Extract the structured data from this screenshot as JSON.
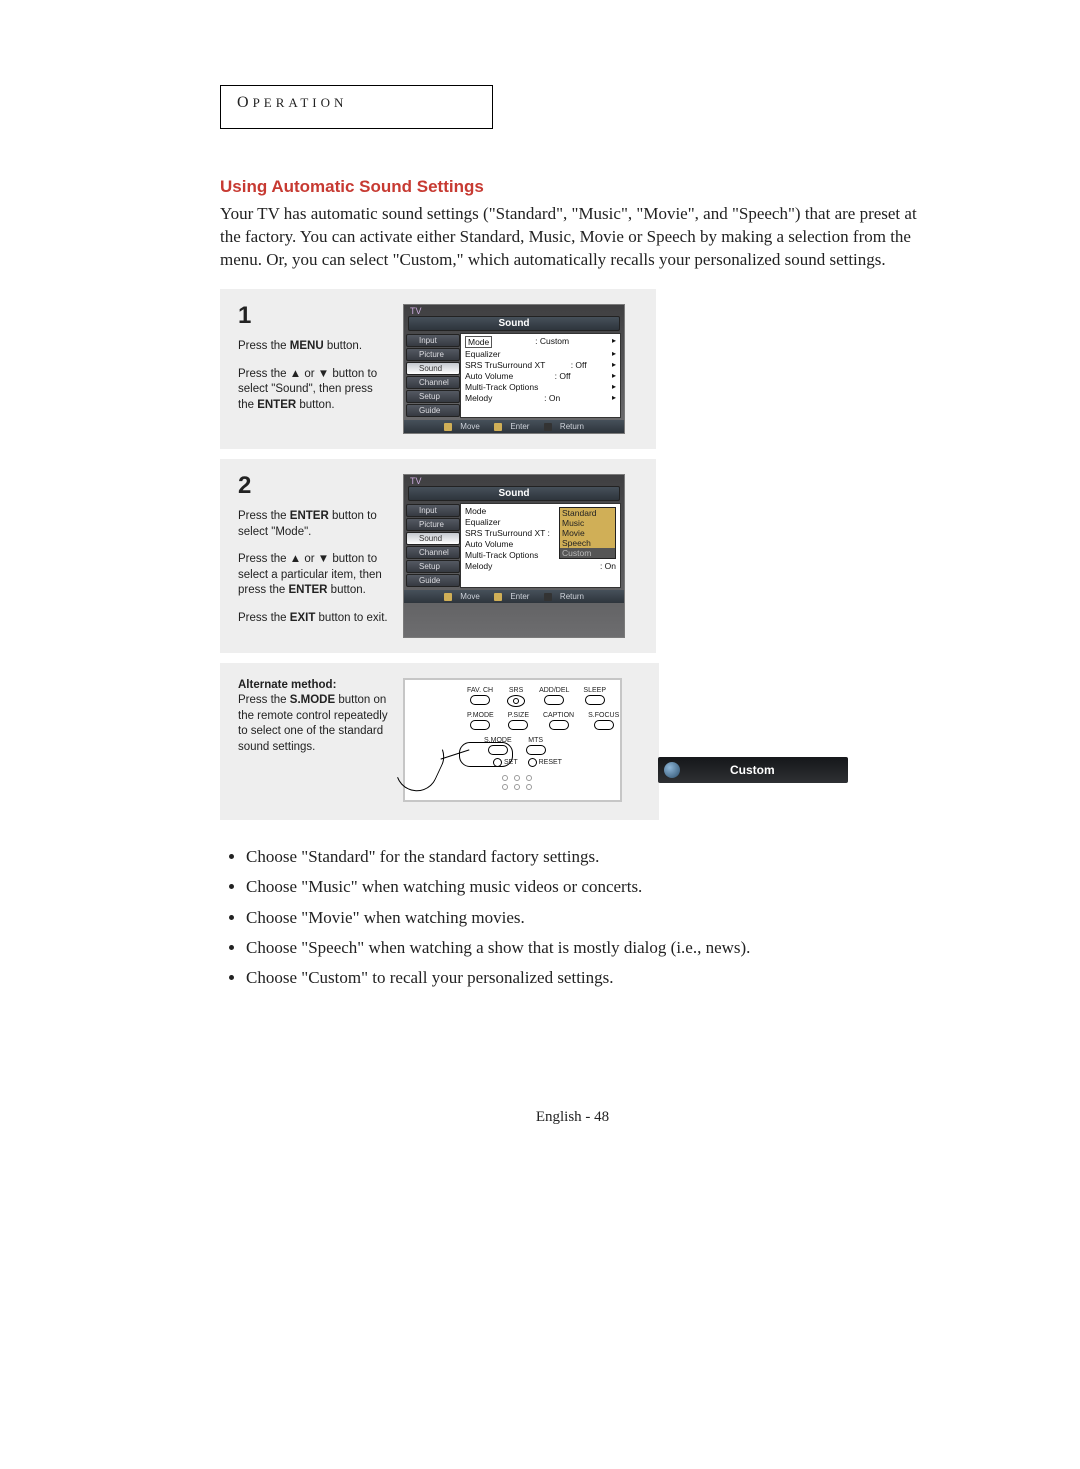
{
  "section_tab": "Operation",
  "heading": "Using Automatic Sound Settings",
  "intro": "Your TV has automatic sound settings (\"Standard\", \"Music\", \"Movie\", and \"Speech\")  that are preset at the factory.  You can activate either Standard, Music, Movie or Speech by making a selection from the menu. Or, you can select \"Custom,\" which automatically recalls your personalized sound settings.",
  "steps": {
    "s1": {
      "number": "1",
      "line_a_pre": "Press the ",
      "line_a_bold": "MENU",
      "line_a_post": " button.",
      "line_b_pre": "Press the ▲ or ▼ button to select \"Sound\", then press the ",
      "line_b_bold": "ENTER",
      "line_b_post": " button."
    },
    "s2": {
      "number": "2",
      "line_a_pre": "Press the ",
      "line_a_bold": "ENTER",
      "line_a_post": " button to select \"Mode\".",
      "line_b_pre": "Press the ▲ or ▼ button to select a particular item, then press the ",
      "line_b_bold": "ENTER",
      "line_b_post": " button.",
      "line_c_pre": "Press the ",
      "line_c_bold": "EXIT",
      "line_c_post": " button to exit."
    }
  },
  "alternate": {
    "title": "Alternate method:",
    "text_pre": "Press the ",
    "text_bold": "S.MODE",
    "text_post": " button on the remote control repeatedly to select one of the standard sound settings."
  },
  "osd": {
    "top_label": "TV",
    "title": "Sound",
    "tabs": [
      "Input",
      "Picture",
      "Sound",
      "Channel",
      "Setup",
      "Guide"
    ],
    "rows": {
      "mode": {
        "label": "Mode",
        "value": ": Custom"
      },
      "equalizer": {
        "label": "Equalizer",
        "value": ""
      },
      "srs": {
        "label": "SRS TruSurround XT",
        "value": ": Off"
      },
      "autovol": {
        "label": "Auto Volume",
        "value": ": Off"
      },
      "multitrack": {
        "label": "Multi-Track Options",
        "value": ""
      },
      "melody": {
        "label": "Melody",
        "value": ": On"
      }
    },
    "rows2": {
      "mode": {
        "label": "Mode",
        "value": ":"
      },
      "equalizer": {
        "label": "Equalizer",
        "value": ""
      },
      "srs": {
        "label": "SRS TruSurround XT :",
        "value": ""
      },
      "autovol": {
        "label": "Auto Volume",
        "value": ":"
      },
      "multitrack": {
        "label": "Multi-Track Options",
        "value": ""
      },
      "melody": {
        "label": "Melody",
        "value": ": On"
      }
    },
    "dropdown": [
      "Standard",
      "Music",
      "Movie",
      "Speech",
      "Custom"
    ],
    "footer": {
      "move": "Move",
      "enter": "Enter",
      "return": "Return"
    }
  },
  "remote": {
    "row1": [
      "FAV. CH",
      "SRS",
      "ADD/DEL",
      "SLEEP"
    ],
    "row2": [
      "P.MODE",
      "P.SIZE",
      "CAPTION",
      "S.FOCUS"
    ],
    "row3": [
      "S.MODE",
      "MTS"
    ],
    "set": "SET",
    "reset": "RESET"
  },
  "toast": "Custom",
  "bullets": [
    "Choose \"Standard\" for the standard factory settings.",
    "Choose \"Music\" when watching music videos or concerts.",
    "Choose \"Movie\" when watching movies.",
    "Choose \"Speech\" when watching a show that is mostly dialog (i.e., news).",
    "Choose \"Custom\" to recall your personalized settings."
  ],
  "footer": "English - 48"
}
